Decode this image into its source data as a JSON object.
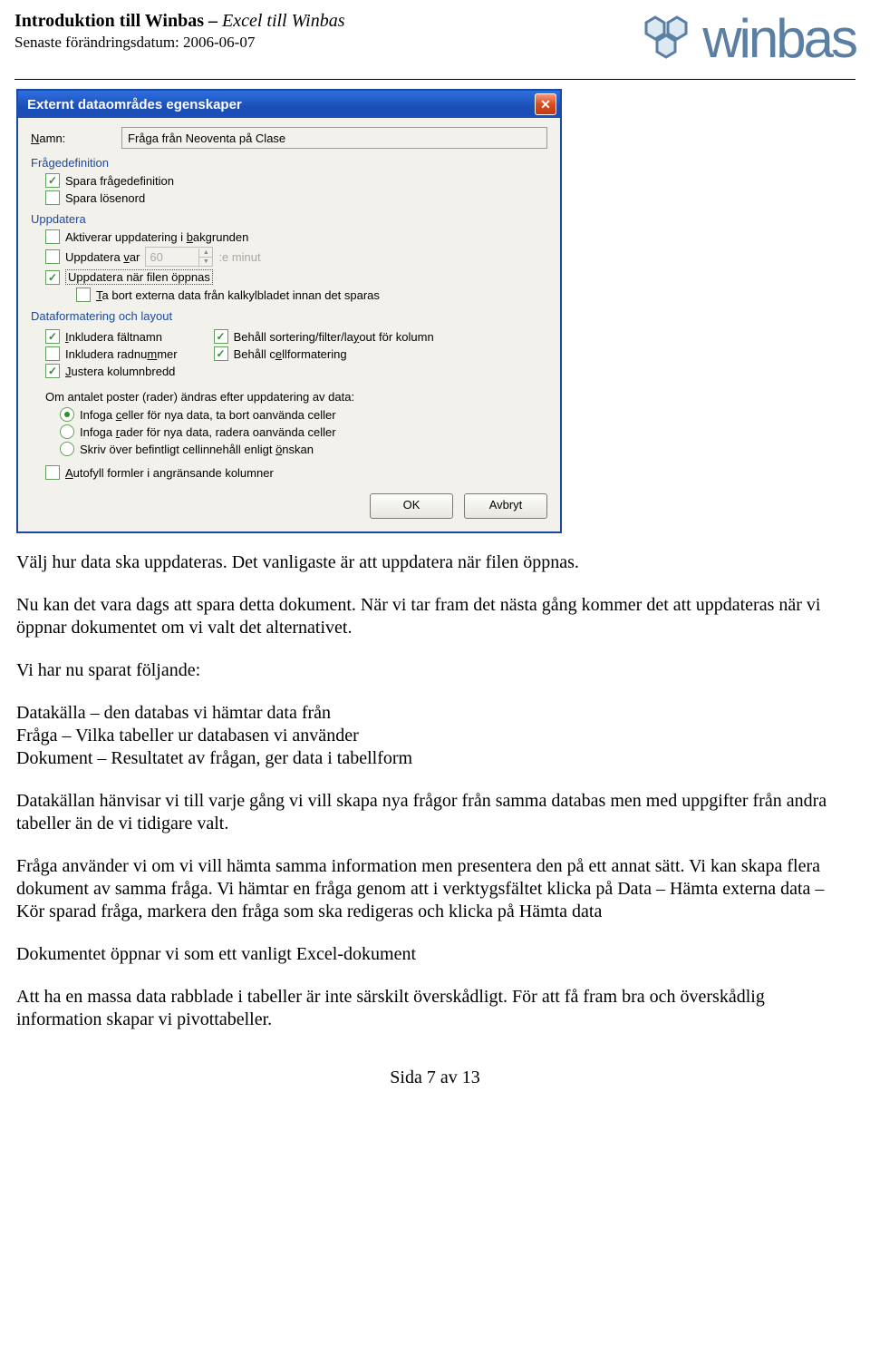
{
  "header": {
    "title_bold": "Introduktion till Winbas – ",
    "title_italic": "Excel till Winbas",
    "date_line": "Senaste förändringsdatum: 2006-06-07",
    "logo_text": "winbas"
  },
  "dialog": {
    "title": "Externt dataområdes egenskaper",
    "namn_label": "Namn:",
    "namn_value": "Fråga från Neoventa på Clase",
    "sections": {
      "fragedef": {
        "title": "Frågedefinition",
        "items": [
          {
            "label": "Spara frågedefinition",
            "checked": true
          },
          {
            "label": "Spara lösenord",
            "checked": false
          }
        ]
      },
      "uppdatera": {
        "title": "Uppdatera",
        "aktiverar": {
          "label_pre": "Aktiverar uppdatering i ",
          "label_acc": "b",
          "label_post": "akgrunden",
          "checked": false
        },
        "var": {
          "label_pre": "Uppdatera ",
          "label_acc": "v",
          "label_post": "ar",
          "checked": false,
          "value": "60",
          "suffix": ":e minut"
        },
        "fil": {
          "label": "Uppdatera när filen öppnas",
          "checked": true
        },
        "tabort": {
          "label_pre": "",
          "label_acc": "T",
          "label_post": "a bort externa data från kalkylbladet innan det sparas",
          "checked": false
        }
      },
      "format": {
        "title": "Dataformatering och layout",
        "left": [
          {
            "acc": "I",
            "post": "nkludera fältnamn",
            "checked": true
          },
          {
            "pre": "Inkludera radnu",
            "acc": "m",
            "post": "mer",
            "checked": false
          },
          {
            "acc": "J",
            "post": "ustera kolumnbredd",
            "checked": true
          }
        ],
        "right": [
          {
            "pre": "Behåll sortering/filter/la",
            "acc": "y",
            "post": "out för kolumn",
            "checked": true
          },
          {
            "pre": "Behåll c",
            "acc": "e",
            "post": "llformatering",
            "checked": true
          }
        ],
        "subtitle": "Om antalet poster (rader) ändras efter uppdatering av data:",
        "radios": [
          {
            "pre": "Infoga ",
            "acc": "c",
            "post": "eller för nya data, ta bort oanvända celler",
            "selected": true
          },
          {
            "pre": "Infoga ",
            "acc": "r",
            "post": "ader för nya data, radera oanvända celler",
            "selected": false
          },
          {
            "pre": "Skriv över befintligt cellinnehåll enligt ",
            "acc": "ö",
            "post": "nskan",
            "selected": false
          }
        ],
        "autofyll": {
          "acc": "A",
          "post": "utofyll formler i angränsande kolumner",
          "checked": false
        }
      }
    },
    "buttons": {
      "ok": "OK",
      "cancel": "Avbryt"
    }
  },
  "body": {
    "p1": "Välj hur data ska uppdateras. Det vanligaste är att uppdatera när filen öppnas.",
    "p2": "Nu kan det vara dags att spara detta dokument. När vi tar fram det nästa gång kommer det att uppdateras när vi öppnar dokumentet om vi valt det alternativet.",
    "p3": "Vi har nu sparat följande:",
    "list1": "Datakälla – den databas vi hämtar data från",
    "list2": "Fråga – Vilka tabeller ur databasen vi använder",
    "list3": "Dokument – Resultatet av frågan, ger data i tabellform",
    "p4": "Datakällan hänvisar vi till varje gång vi vill skapa nya frågor från samma databas men med uppgifter från andra tabeller än de vi tidigare valt.",
    "p5": "Fråga använder vi om vi vill hämta samma information men presentera den på ett annat sätt. Vi kan skapa flera dokument av samma fråga. Vi hämtar en fråga genom att i verktygsfältet klicka på Data – Hämta externa data – Kör sparad fråga, markera den fråga som ska redigeras och klicka på Hämta data",
    "p6": "Dokumentet öppnar vi som ett vanligt Excel-dokument",
    "p7": "Att ha en massa data rabblade i tabeller är inte särskilt överskådligt. För att få fram bra och överskådlig information skapar vi pivottabeller."
  },
  "footer": "Sida 7 av 13"
}
